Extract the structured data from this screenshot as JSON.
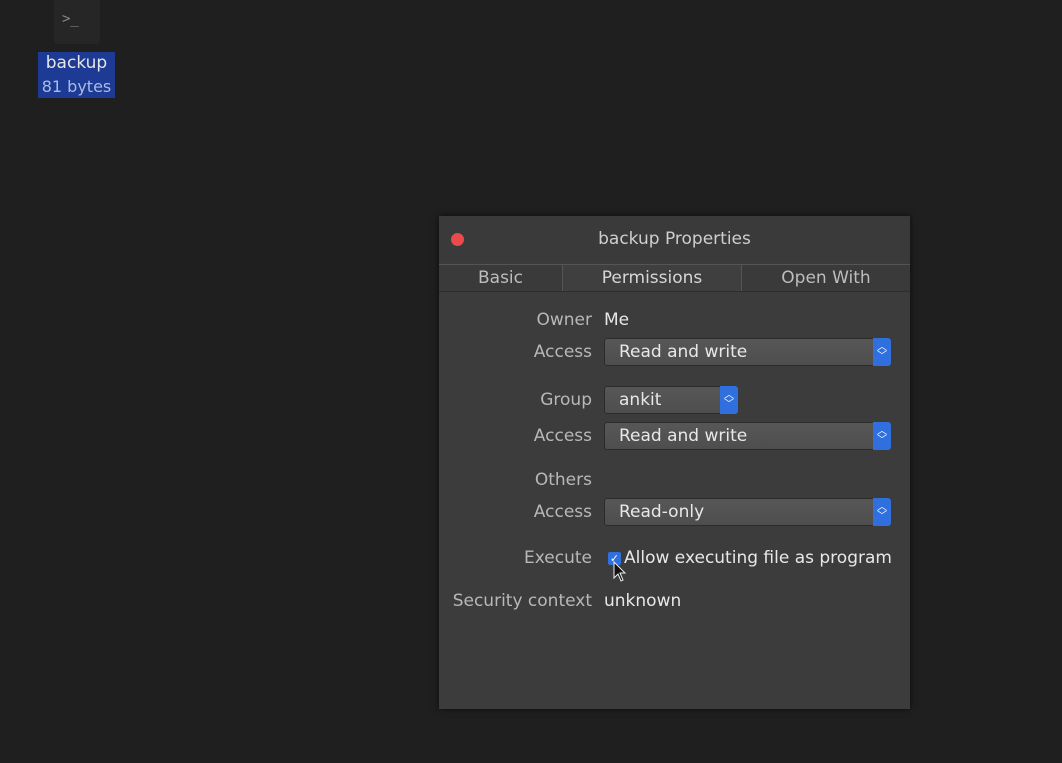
{
  "desktop": {
    "file_icon_glyph": ">_",
    "file_name": "backup",
    "file_size": "81 bytes"
  },
  "dialog": {
    "title": "backup Properties",
    "tabs": [
      {
        "label": "Basic"
      },
      {
        "label": "Permissions",
        "active": true
      },
      {
        "label": "Open With"
      }
    ],
    "owner": {
      "label": "Owner",
      "value": "Me"
    },
    "owner_access": {
      "label": "Access",
      "value": "Read and write"
    },
    "group": {
      "label": "Group",
      "value": "ankit"
    },
    "group_access": {
      "label": "Access",
      "value": "Read and write"
    },
    "others": {
      "label": "Others"
    },
    "others_access": {
      "label": "Access",
      "value": "Read-only"
    },
    "execute": {
      "label": "Execute",
      "checkbox_label": "Allow executing file as program",
      "checked": true
    },
    "security": {
      "label": "Security context",
      "value": "unknown"
    }
  },
  "colors": {
    "accent": "#2f6fde",
    "close": "#e74c4c",
    "selection": "#1d3a94"
  }
}
